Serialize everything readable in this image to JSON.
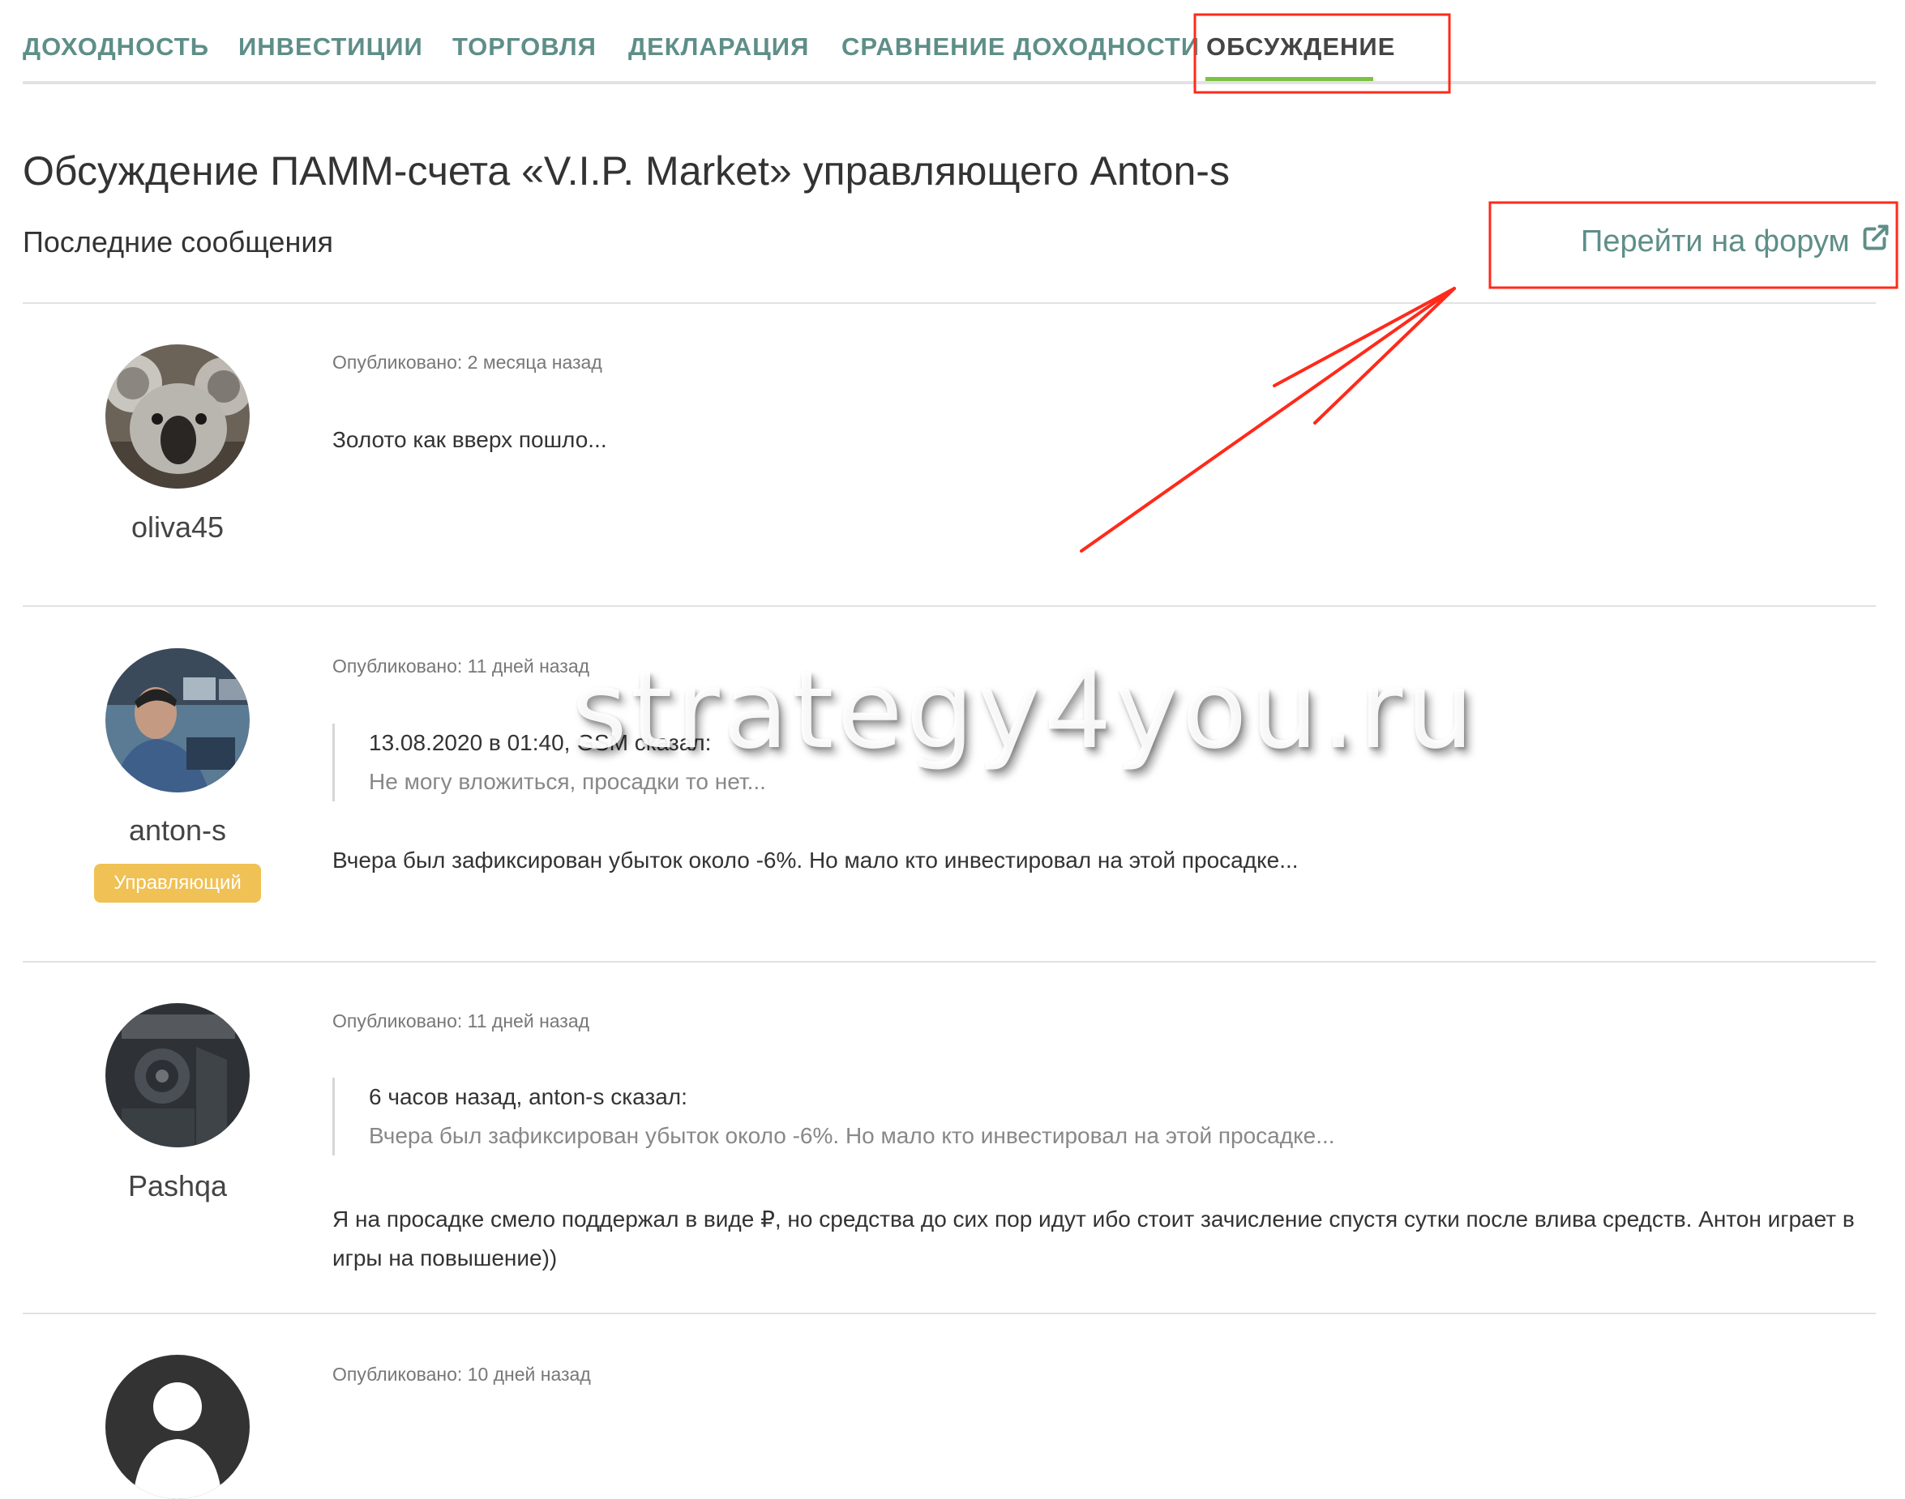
{
  "tabs": [
    {
      "label": "ДОХОДНОСТЬ"
    },
    {
      "label": "ИНВЕСТИЦИИ"
    },
    {
      "label": "ТОРГОВЛЯ"
    },
    {
      "label": "ДЕКЛАРАЦИЯ"
    },
    {
      "label": "СРАВНЕНИЕ ДОХОДНОСТИ"
    },
    {
      "label": "ОБСУЖДЕНИЕ",
      "active": true
    }
  ],
  "page_title": "Обсуждение ПАММ-счета «V.I.P. Market» управляющего Anton-s",
  "section_title": "Последние сообщения",
  "forum_link": {
    "label": "Перейти на форум",
    "icon": "external-link-icon"
  },
  "posts": [
    {
      "username": "oliva45",
      "avatar_icon": "koala-avatar",
      "published": "Опубликовано: 2 месяца назад",
      "text": "Золото как вверх пошло..."
    },
    {
      "username": "anton-s",
      "avatar_icon": "trader-avatar",
      "badge": "Управляющий",
      "published": "Опубликовано: 11 дней назад",
      "quote_head": "13.08.2020 в 01:40, GSM сказал:",
      "quote_text": "Не могу вложиться, просадки то нет...",
      "text": "Вчера был зафиксирован убыток около -6%. Но мало кто инвестировал на этой просадке..."
    },
    {
      "username": "Pashqa",
      "avatar_icon": "stone-carving-avatar",
      "published": "Опубликовано: 11 дней назад",
      "quote_head": "6 часов назад, anton-s сказал:",
      "quote_text": "Вчера был зафиксирован убыток около -6%. Но мало кто инвестировал на этой просадке...",
      "text": "Я на просадке смело поддержал в виде ₽, но средства до сих пор идут ибо стоит зачисление спустя сутки после влива средств. Антон играет в игры на повышение))"
    },
    {
      "avatar_icon": "default-user-avatar",
      "published": "Опубликовано: 10 дней назад"
    }
  ],
  "watermark": "strategy4you.ru",
  "colors": {
    "tab": "#5e8e88",
    "active_underline": "#7cc242",
    "badge": "#f0c154",
    "annotation": "#ff2a1a"
  }
}
